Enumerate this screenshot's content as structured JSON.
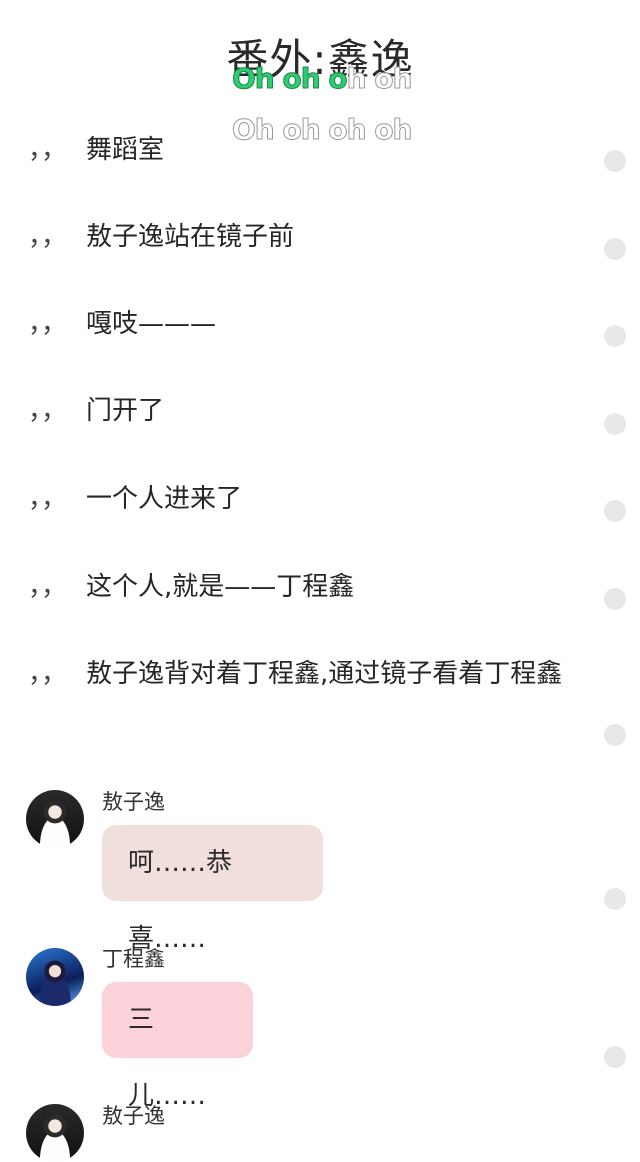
{
  "title": "番外:鑫逸",
  "lyrics": {
    "line1_green": "Oh oh o",
    "line1_outline": "h oh",
    "line2": "Oh oh oh oh"
  },
  "colors": {
    "background": "#ffffff",
    "bubble_aozi": "#f1dfdb",
    "bubble_ding": "#fcd2da",
    "lyric_green": "#2ecc71",
    "dot": "#e8e8e8"
  },
  "narration_prefix": "，，",
  "narration": [
    "舞蹈室",
    "敖子逸站在镜子前",
    "嘎吱———",
    "门开了",
    "一个人进来了",
    "这个人,就是——丁程鑫",
    "敖子逸背对着丁程鑫,通过镜子看着丁程鑫"
  ],
  "messages": [
    {
      "speaker": "敖子逸",
      "text": "呵……恭喜……",
      "avatar_icon": "avatar-aoziyi"
    },
    {
      "speaker": "丁程鑫",
      "text": "三儿……",
      "avatar_icon": "avatar-dingchengxin"
    },
    {
      "speaker": "敖子逸",
      "text": "",
      "avatar_icon": "avatar-aoziyi"
    }
  ]
}
